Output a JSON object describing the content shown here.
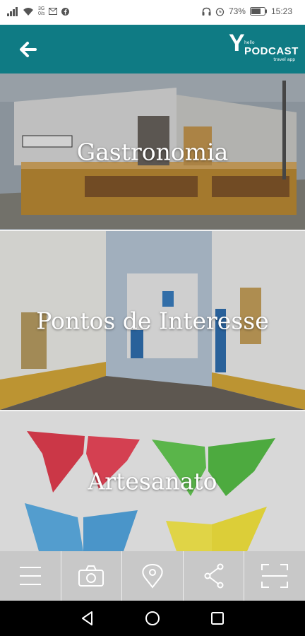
{
  "status_bar": {
    "signal_label_top": "3G",
    "signal_label_bottom": "0/s",
    "battery": "73%",
    "time": "15:23"
  },
  "app_bar": {
    "logo_letter": "Y",
    "logo_small": "hello",
    "logo_text": "PODCAST",
    "logo_tagline": "travel app"
  },
  "categories": [
    {
      "label": "Gastronomia"
    },
    {
      "label": "Pontos de Interesse"
    },
    {
      "label": "Artesanato"
    }
  ],
  "colors": {
    "app_bar": "#0f7b84",
    "bottom_nav": "#bebebe",
    "system_nav": "#000000"
  },
  "bottom_nav": [
    {
      "icon": "menu-icon"
    },
    {
      "icon": "camera-icon"
    },
    {
      "icon": "location-pin-icon"
    },
    {
      "icon": "share-icon"
    },
    {
      "icon": "scan-icon"
    }
  ],
  "system_nav": [
    {
      "icon": "back-triangle-icon"
    },
    {
      "icon": "home-circle-icon"
    },
    {
      "icon": "recents-square-icon"
    }
  ]
}
